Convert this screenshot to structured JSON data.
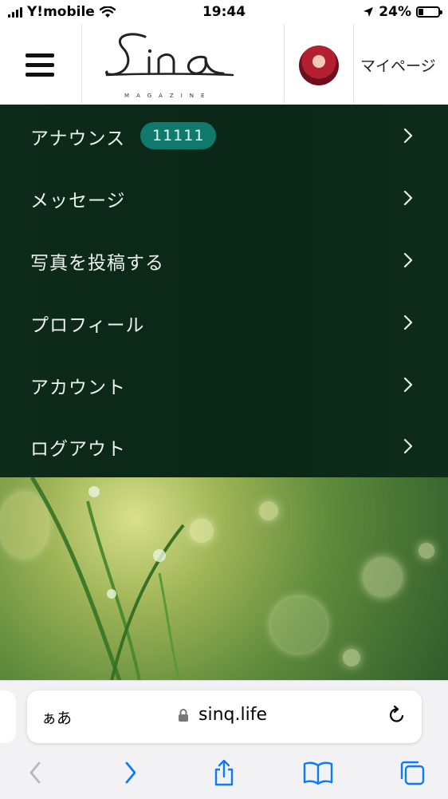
{
  "status_bar": {
    "carrier": "Y!mobile",
    "time": "19:44",
    "battery": "24%",
    "battery_level": 0.24
  },
  "header": {
    "logo_text": "Sinq",
    "logo_subtitle": "MAGAZINE",
    "mypage_label": "マイページ"
  },
  "menu": {
    "items": [
      {
        "label": "アナウンス",
        "badge": "11111"
      },
      {
        "label": "メッセージ"
      },
      {
        "label": "写真を投稿する"
      },
      {
        "label": "プロフィール"
      },
      {
        "label": "アカウント"
      },
      {
        "label": "ログアウト"
      }
    ]
  },
  "browser": {
    "aa_label": "ぁあ",
    "host": "sinq.life"
  },
  "colors": {
    "menu_bg": "#0b2717",
    "badge_bg": "#0f7a6c",
    "ios_blue": "#0a7aff"
  }
}
